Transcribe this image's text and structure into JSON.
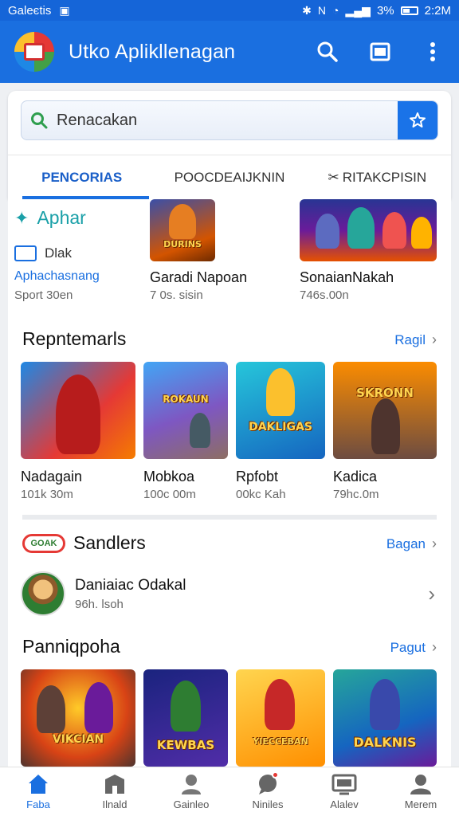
{
  "status_bar": {
    "carrier": "Galeєtis",
    "battery_pct": "3%",
    "time": "2:2M"
  },
  "app_bar": {
    "title": "Utko Aplikllenagan",
    "icons": [
      "search-icon",
      "window-icon",
      "more-vert-icon"
    ]
  },
  "search": {
    "placeholder": "Renacakan"
  },
  "tabs": [
    {
      "label": "PENCORIAS",
      "active": true
    },
    {
      "label": "POOCDEAIJKNIN",
      "active": false
    },
    {
      "label": "RITAKCPISIN",
      "active": false
    }
  ],
  "featured": {
    "heading": "Aphar",
    "sub_label": "Dlak",
    "name": "Aphachasnang",
    "meta": "Sport 30en",
    "items": [
      {
        "name": "Garadi Napoan",
        "meta": "7 0s. sisin",
        "art": "DURINS"
      },
      {
        "name": "SonaianNakah",
        "meta": "746s.00n",
        "art": ""
      }
    ]
  },
  "sections": {
    "recommended": {
      "title": "Repntemarls",
      "more": "Ragil",
      "apps": [
        {
          "name": "Nadagain",
          "meta": "101k 30m",
          "art": ""
        },
        {
          "name": "Mobkoa",
          "meta": "100c 00m",
          "art": "ROKAUN"
        },
        {
          "name": "Rpfobt",
          "meta": "00kc Kah",
          "art": "DAKLIGAS"
        },
        {
          "name": "Kadica",
          "meta": "79hc.0m",
          "art": "SKRONN"
        }
      ]
    },
    "sandlers": {
      "title": "Sandlers",
      "badge": "GOAK",
      "more": "Bagan",
      "row": {
        "title": "Daniaiac Odakal",
        "sub": "96h. lsoh"
      }
    },
    "popular": {
      "title": "Panniqpoha",
      "more": "Pagut",
      "apps": [
        {
          "art": "VIKCIAN"
        },
        {
          "art": "KEWBAS"
        },
        {
          "art": "YIECCEBAN"
        },
        {
          "art": "DALKNIS"
        }
      ]
    }
  },
  "bottom_nav": [
    {
      "label": "Faba",
      "icon": "home-icon",
      "active": true
    },
    {
      "label": "Ilnald",
      "icon": "store-icon",
      "active": false
    },
    {
      "label": "Gainleo",
      "icon": "person-icon",
      "active": false
    },
    {
      "label": "Niniles",
      "icon": "chat-icon",
      "active": false
    },
    {
      "label": "Alalev",
      "icon": "tv-icon",
      "active": false
    },
    {
      "label": "Merem",
      "icon": "account-icon",
      "active": false
    }
  ],
  "colors": {
    "primary": "#1a6fe0",
    "status_bar": "#1565d8",
    "accent_red": "#e53935"
  }
}
